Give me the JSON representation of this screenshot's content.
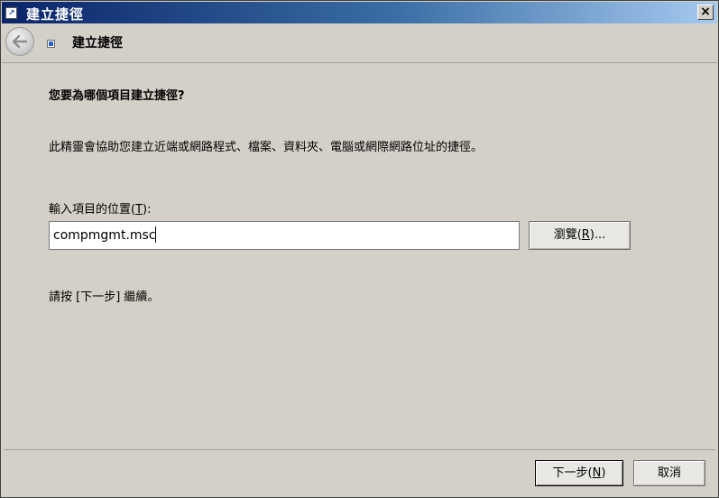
{
  "window": {
    "title": "建立捷徑",
    "close_label": "×"
  },
  "header": {
    "title": "建立捷徑"
  },
  "main": {
    "question": "您要為哪個項目建立捷徑?",
    "description": "此精靈會協助您建立近端或網路程式、檔案、資料夾、電腦或網際網路位址的捷徑。",
    "location_label_prefix": "輸入項目的位置(",
    "location_label_key": "T",
    "location_label_suffix": "):",
    "location_value": "compmgmt.msc",
    "browse_prefix": "瀏覽(",
    "browse_key": "R",
    "browse_suffix": ")...",
    "continue_text": "請按 [下一步] 繼續。"
  },
  "footer": {
    "next_prefix": "下一步(",
    "next_key": "N",
    "next_suffix": ")",
    "cancel_label": "取消"
  },
  "icons": {
    "back": "back-arrow-icon",
    "shortcut": "shortcut-icon",
    "close": "close-icon"
  },
  "colors": {
    "titlebar_start": "#0a246a",
    "titlebar_end": "#a6caf0",
    "dialog_bg": "#d4d0c8"
  }
}
